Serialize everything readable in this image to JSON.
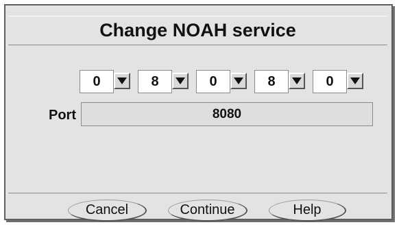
{
  "dialog": {
    "title": "Change NOAH service"
  },
  "digits": [
    {
      "value": "0",
      "icon": "chevron-down-icon"
    },
    {
      "value": "8",
      "icon": "chevron-down-icon"
    },
    {
      "value": "0",
      "icon": "chevron-down-icon"
    },
    {
      "value": "8",
      "icon": "chevron-down-icon"
    },
    {
      "value": "0",
      "icon": "chevron-down-icon"
    }
  ],
  "port": {
    "label": "Port",
    "value": "8080"
  },
  "buttons": {
    "cancel_label": "Cancel",
    "continue_label": "Continue",
    "help_label": "Help"
  }
}
